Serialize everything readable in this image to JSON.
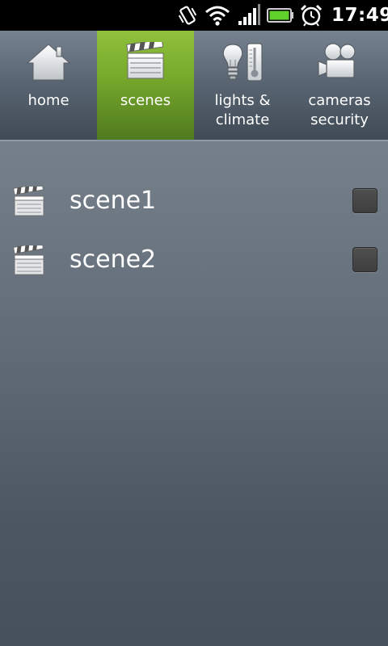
{
  "status_bar": {
    "time": "17:49",
    "icons": [
      "vibrate-icon",
      "wifi-icon",
      "signal-icon",
      "battery-icon",
      "alarm-icon"
    ],
    "battery_color": "#5fd12b"
  },
  "tabs": [
    {
      "label": "home",
      "icon": "home-icon",
      "selected": false
    },
    {
      "label": "scenes",
      "icon": "clapperboard-icon",
      "selected": true
    },
    {
      "label": "lights &\nclimate",
      "icon": "bulb-thermometer-icon",
      "selected": false
    },
    {
      "label": "cameras\nsecurity",
      "icon": "video-camera-icon",
      "selected": false
    }
  ],
  "accent_color": "#7fb334",
  "scenes": [
    {
      "label": "scene1",
      "icon": "clapperboard-icon",
      "checked": false
    },
    {
      "label": "scene2",
      "icon": "clapperboard-icon",
      "checked": false
    }
  ]
}
